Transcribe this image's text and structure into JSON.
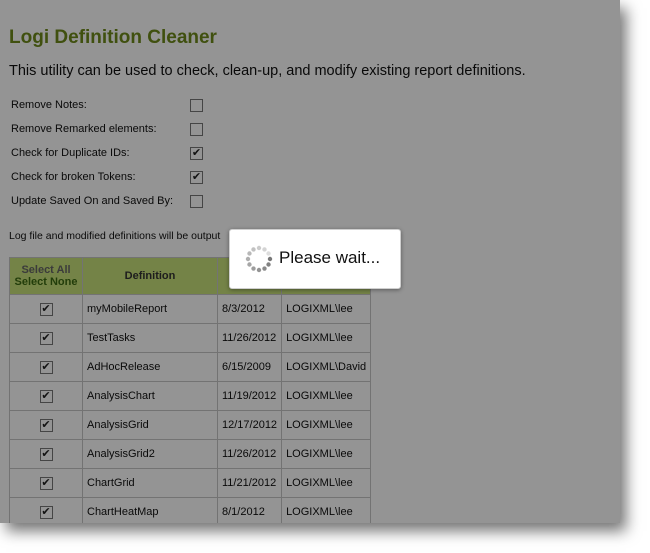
{
  "page": {
    "title": "Logi Definition Cleaner",
    "subtitle": "This utility can be used to check, clean-up, and modify existing report definitions."
  },
  "options": [
    {
      "label": "Remove Notes:",
      "checked": false
    },
    {
      "label": "Remove Remarked elements:",
      "checked": false
    },
    {
      "label": "Check for Duplicate IDs:",
      "checked": true
    },
    {
      "label": "Check for broken Tokens:",
      "checked": true
    },
    {
      "label": "Update Saved On and Saved By:",
      "checked": false
    }
  ],
  "output_note": "Log file and modified definitions will be output",
  "table": {
    "select_all": "Select All",
    "select_none": "Select None",
    "definition_header": "Definition",
    "rows": [
      {
        "checked": true,
        "definition": "myMobileReport",
        "date": "8/3/2012",
        "user": "LOGIXML\\lee"
      },
      {
        "checked": true,
        "definition": "TestTasks",
        "date": "11/26/2012",
        "user": "LOGIXML\\lee"
      },
      {
        "checked": true,
        "definition": "AdHocRelease",
        "date": "6/15/2009",
        "user": "LOGIXML\\David"
      },
      {
        "checked": true,
        "definition": "AnalysisChart",
        "date": "11/19/2012",
        "user": "LOGIXML\\lee"
      },
      {
        "checked": true,
        "definition": "AnalysisGrid",
        "date": "12/17/2012",
        "user": "LOGIXML\\lee"
      },
      {
        "checked": true,
        "definition": "AnalysisGrid2",
        "date": "11/26/2012",
        "user": "LOGIXML\\lee"
      },
      {
        "checked": true,
        "definition": "ChartGrid",
        "date": "11/21/2012",
        "user": "LOGIXML\\lee"
      },
      {
        "checked": true,
        "definition": "ChartHeatMap",
        "date": "8/1/2012",
        "user": "LOGIXML\\lee"
      }
    ]
  },
  "wait_dialog": {
    "text": "Please wait...",
    "icon": "spinner-icon"
  },
  "colors": {
    "title": "#6e8a1a",
    "header_bg": "#c9e27a",
    "select_none": "#3b6a12"
  }
}
